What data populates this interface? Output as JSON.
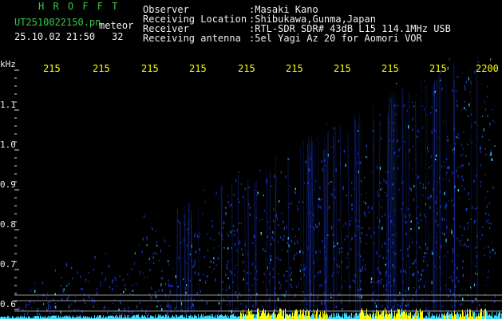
{
  "header": {
    "station_code": "H R O F F T",
    "file_name": "UT2510022150.pn",
    "mode_label": "meteor",
    "datetime": "25.10.02 21:50",
    "count": "32",
    "fields": [
      {
        "label": "Observer",
        "value": ":Masaki Kano"
      },
      {
        "label": "Receiving Location",
        "value": ":Shibukawa,Gunma,Japan"
      },
      {
        "label": "Receiver",
        "value": ":RTL-SDR SDR# 43dB L15 114.1MHz USB"
      },
      {
        "label": "Receiving antenna",
        "value": ":5el Yagi Az 20 for Aomori VOR"
      }
    ]
  },
  "axis": {
    "unit_label": "kHz",
    "time_ticks": [
      "215",
      "215",
      "215",
      "215",
      "215",
      "215",
      "215",
      "215",
      "215",
      "2200"
    ],
    "freq_ticks": [
      "1.1",
      "1.0",
      "0.9",
      "0.8",
      "0.7",
      "0.6"
    ]
  },
  "colors": {
    "background": "#000000",
    "header_green": "#33cc44",
    "header_white": "#f0f0f0",
    "tick_yellow": "#ffff00",
    "signal_blue": "#1e3cd2",
    "signal_cyan": "#3cdcff",
    "baseline_yellow": "#ffff00"
  }
}
